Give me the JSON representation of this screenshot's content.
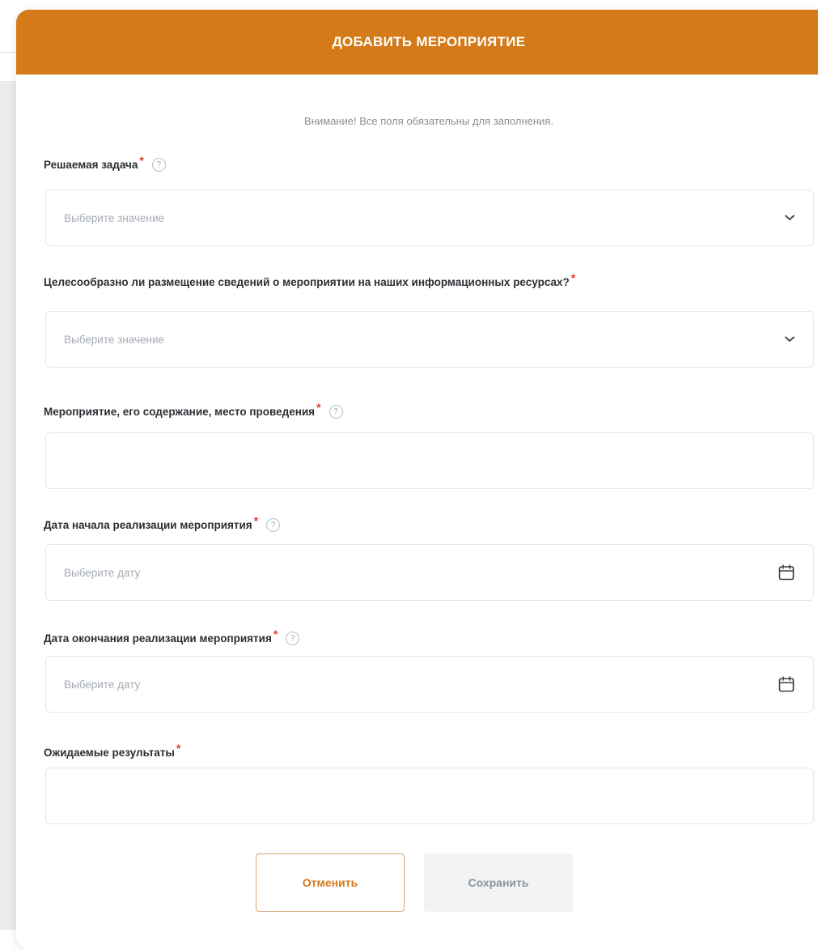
{
  "modal": {
    "title": "ДОБАВИТЬ МЕРОПРИЯТИЕ",
    "close_symbol": "×",
    "notice": "Внимание! Все поля обязательны для заполнения."
  },
  "fields": [
    {
      "label": "Решаемая задача",
      "required": "*",
      "has_help": true,
      "type": "select",
      "placeholder": "Выберите значение",
      "icon": "chevron-down-icon"
    },
    {
      "label": "Целесообразно ли размещение сведений о мероприятии на наших информационных ресурсах?",
      "required": "*",
      "has_help": false,
      "type": "select",
      "placeholder": "Выберите значение",
      "icon": "chevron-down-icon"
    },
    {
      "label": "Мероприятие, его содержание, место проведения",
      "required": "*",
      "has_help": true,
      "type": "text",
      "placeholder": ""
    },
    {
      "label": "Дата начала реализации мероприятия",
      "required": "*",
      "has_help": true,
      "type": "date",
      "placeholder": "Выберите дату",
      "icon": "calendar-icon"
    },
    {
      "label": "Дата окончания реализации мероприятия",
      "required": "*",
      "has_help": true,
      "type": "date",
      "placeholder": "Выберите дату",
      "icon": "calendar-icon"
    },
    {
      "label": "Ожидаемые результаты",
      "required": "*",
      "has_help": false,
      "type": "text",
      "placeholder": ""
    }
  ],
  "help_symbol": "?",
  "buttons": {
    "cancel": "Отменить",
    "save": "Сохранить"
  },
  "colors": {
    "header": "#d47a19",
    "required": "#e03a2f",
    "cancel_text": "#d47a19"
  }
}
